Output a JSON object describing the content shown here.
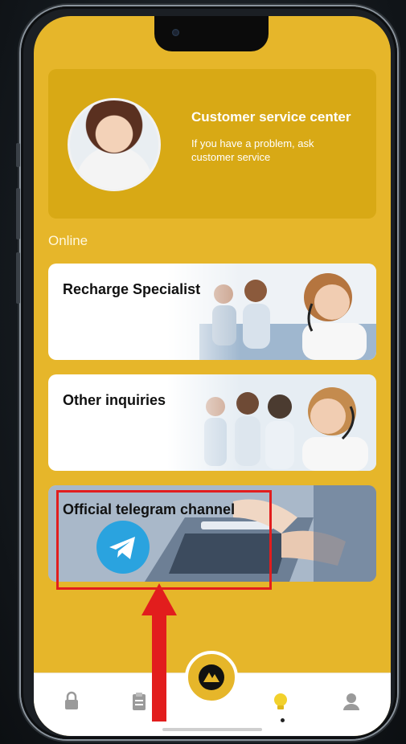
{
  "cs_card": {
    "title": "Customer service center",
    "subtitle": "If you have a problem, ask customer service"
  },
  "section_label": "Online",
  "services": [
    {
      "label": "Recharge Specialist"
    },
    {
      "label": "Other inquiries"
    },
    {
      "label": "Official telegram channel"
    }
  ],
  "tabbar": {
    "icons": [
      "lock-icon",
      "clipboard-icon",
      "brand-logo-icon",
      "lightbulb-icon",
      "user-icon"
    ]
  },
  "colors": {
    "accent": "#e6b62a",
    "highlight": "#e21d1d"
  }
}
